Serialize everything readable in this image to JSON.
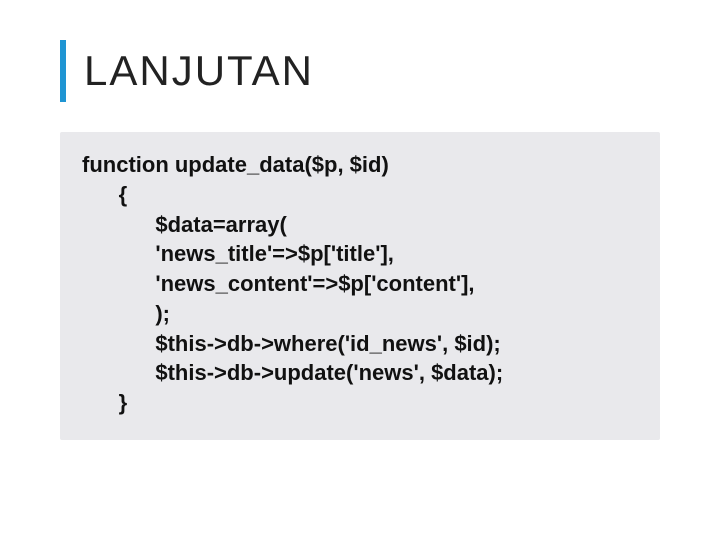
{
  "title": "LANJUTAN",
  "code": {
    "l0": "function update_data($p, $id)",
    "l1": "      {",
    "l2": "            $data=array(",
    "l3": "            'news_title'=>$p['title'],",
    "l4": "            'news_content'=>$p['content'],",
    "l5": "            );",
    "l6": "            $this->db->where('id_news', $id);",
    "l7": "            $this->db->update('news', $data);",
    "l8": "      }"
  }
}
